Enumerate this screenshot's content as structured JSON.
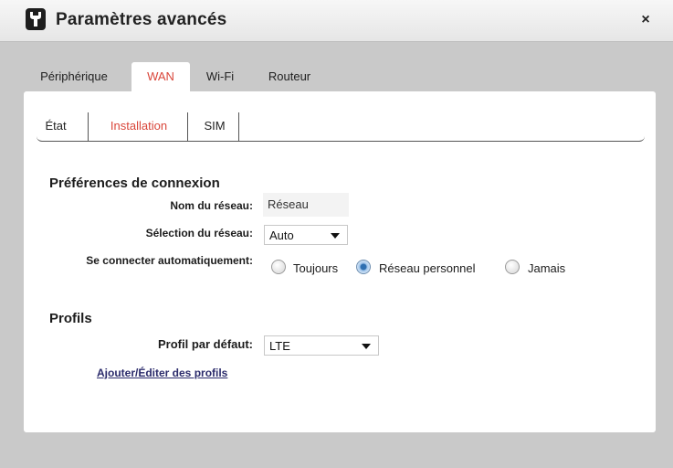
{
  "window": {
    "title": "Paramètres avancés",
    "close_glyph": "×",
    "app_icon": "wrench-icon"
  },
  "main_tabs": [
    {
      "label": "Périphérique",
      "active": false
    },
    {
      "label": "WAN",
      "active": true
    },
    {
      "label": "Wi-Fi",
      "active": false
    },
    {
      "label": "Routeur",
      "active": false
    }
  ],
  "sub_tabs": [
    {
      "label": "État",
      "active": false
    },
    {
      "label": "Installation",
      "active": true
    },
    {
      "label": "SIM",
      "active": false
    }
  ],
  "connection": {
    "section_title": "Préférences de connexion",
    "network_name_label": "Nom du réseau:",
    "network_name_value": "Réseau",
    "network_selection_label": "Sélection du réseau:",
    "network_selection_value": "Auto",
    "auto_connect_label": "Se connecter automatiquement:",
    "auto_connect_options": [
      {
        "label": "Toujours",
        "checked": false
      },
      {
        "label": "Réseau personnel",
        "checked": true
      },
      {
        "label": "Jamais",
        "checked": false
      }
    ]
  },
  "profiles": {
    "section_title": "Profils",
    "default_profile_label": "Profil par défaut:",
    "default_profile_value": "LTE",
    "edit_link": "Ajouter/Éditer des profils"
  },
  "colors": {
    "accent": "#d9463a",
    "link": "#2b2b6b",
    "frame": "#c9c9c9"
  }
}
